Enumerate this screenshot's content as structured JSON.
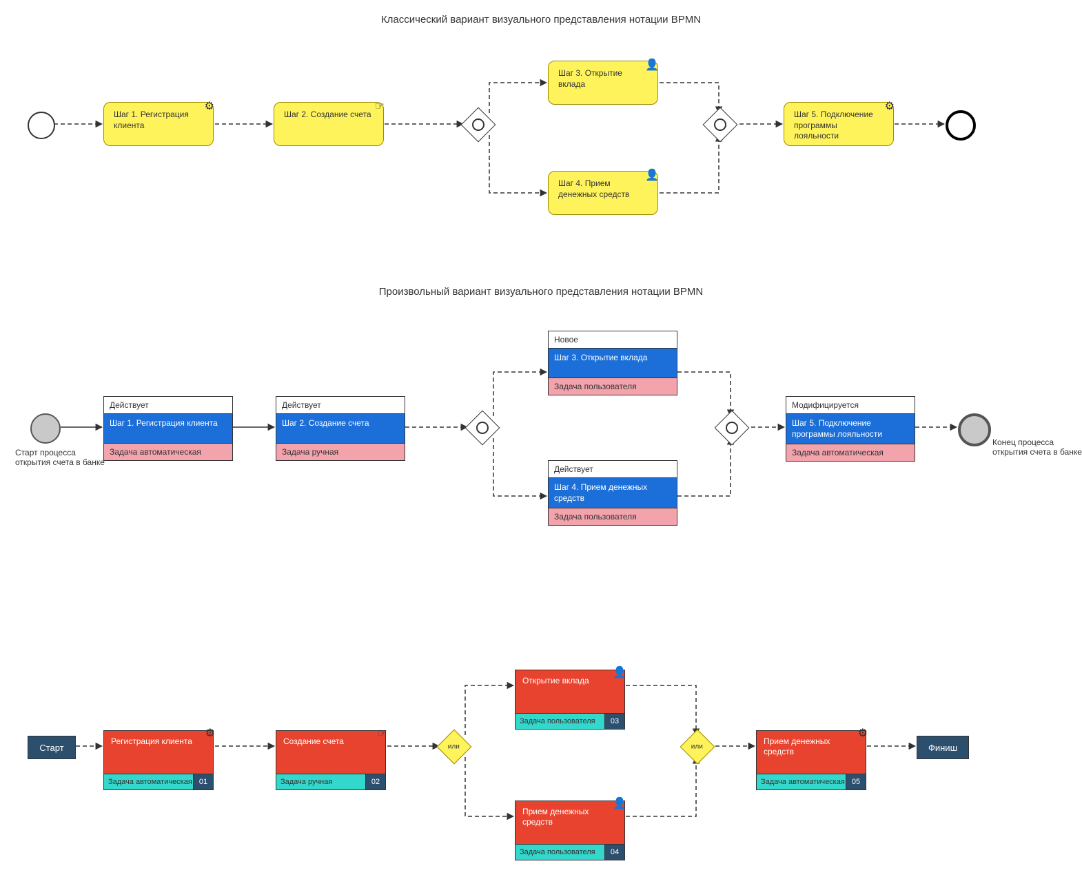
{
  "titles": {
    "section1": "Классический вариант визуального представления нотации BPMN",
    "section2": "Произвольный вариант визуального представления нотации BPMN"
  },
  "section1": {
    "tasks": [
      {
        "label": "Шаг 1. Регистрация клиента",
        "icon": "gear"
      },
      {
        "label": "Шаг 2. Создание счета",
        "icon": "hand"
      },
      {
        "label": "Шаг 3. Открытие вклада",
        "icon": "user"
      },
      {
        "label": "Шаг 4. Прием денежных средств",
        "icon": "user"
      },
      {
        "label": "Шаг 5. Подключение программы лояльности",
        "icon": "gear"
      }
    ]
  },
  "section2": {
    "start_caption": "Старт процесса открытия счета в банке",
    "end_caption": "Конец процесса открытия счета в банке",
    "tasks": [
      {
        "status": "Действует",
        "name": "Шаг 1. Регистрация клиента",
        "type": "Задача автоматическая"
      },
      {
        "status": "Действует",
        "name": "Шаг 2. Создание счета",
        "type": "Задача ручная"
      },
      {
        "status": "Новое",
        "name": "Шаг 3. Открытие вклада",
        "type": "Задача пользователя"
      },
      {
        "status": "Действует",
        "name": "Шаг 4. Прием денежных средств",
        "type": "Задача пользователя"
      },
      {
        "status": "Модифицируется",
        "name": "Шаг 5. Подключение программы лояльности",
        "type": "Задача автоматическая"
      }
    ]
  },
  "section3": {
    "start": "Старт",
    "finish": "Финиш",
    "gateway_label": "или",
    "tasks": [
      {
        "name": "Регистрация клиента",
        "type": "Задача автоматическая",
        "num": "01",
        "icon": "gear"
      },
      {
        "name": "Создание счета",
        "type": "Задача ручная",
        "num": "02",
        "icon": "hand"
      },
      {
        "name": "Открытие вклада",
        "type": "Задача пользователя",
        "num": "03",
        "icon": "user"
      },
      {
        "name": "Прием денежных средств",
        "type": "Задача пользователя",
        "num": "04",
        "icon": "user"
      },
      {
        "name": "Прием денежных средств",
        "type": "Задача автоматическая",
        "num": "05",
        "icon": "gear"
      }
    ]
  },
  "icons": {
    "gear": "⚙",
    "hand": "☞",
    "user": "👤"
  }
}
